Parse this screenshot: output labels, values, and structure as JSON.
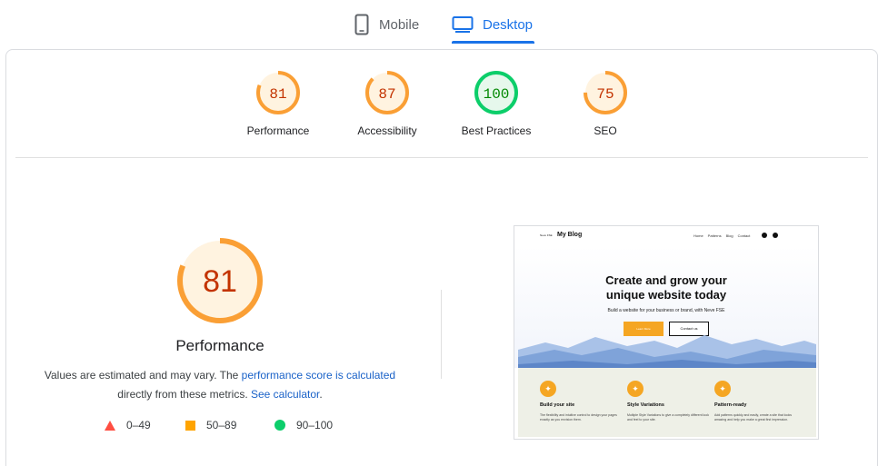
{
  "tabs": {
    "mobile": "Mobile",
    "desktop": "Desktop"
  },
  "gauges": [
    {
      "score": "81",
      "label": "Performance",
      "value": 81,
      "color": "#fa9f35",
      "text_color": "#c33300",
      "bg": "#fff3e0"
    },
    {
      "score": "87",
      "label": "Accessibility",
      "value": 87,
      "color": "#fa9f35",
      "text_color": "#c33300",
      "bg": "#fff3e0"
    },
    {
      "score": "100",
      "label": "Best Practices",
      "value": 100,
      "color": "#0cce6a",
      "text_color": "#008800",
      "bg": "#e6f8ec"
    },
    {
      "score": "75",
      "label": "SEO",
      "value": 75,
      "color": "#fa9f35",
      "text_color": "#c33300",
      "bg": "#fff3e0"
    }
  ],
  "performance": {
    "score": "81",
    "value": 81,
    "title": "Performance",
    "desc_prefix": "Values are estimated and may vary. The ",
    "desc_link1": "performance score is calculated",
    "desc_middle": "directly from these metrics. ",
    "desc_link2": "See calculator",
    "desc_suffix": "."
  },
  "legend": [
    {
      "range": "0–49",
      "shape": "triangle",
      "color": "#ff4e42"
    },
    {
      "range": "50–89",
      "shape": "square",
      "color": "#ffa400"
    },
    {
      "range": "90–100",
      "shape": "circle",
      "color": "#0cce6b"
    }
  ],
  "preview": {
    "brand_small": "Neve FSE",
    "brand": "My Blog",
    "nav": [
      "Home",
      "Patterns",
      "Blog",
      "Contact"
    ],
    "hero_line1": "Create and grow your",
    "hero_line2": "unique website today",
    "subtitle": "Build a website for your business or brand, with Neve FSE",
    "btn_primary": "Learn More",
    "btn_secondary": "Contact us",
    "features": [
      {
        "title": "Build your site",
        "desc": "The flexibility and intuitive control to design your pages exactly as you envision them."
      },
      {
        "title": "Style Variations",
        "desc": "Multiple Style Variations to give a completely different look and feel to your site."
      },
      {
        "title": "Pattern-ready",
        "desc": "Add patterns quickly and easily, create a site that looks amazing and help you make a great first impression."
      }
    ]
  }
}
